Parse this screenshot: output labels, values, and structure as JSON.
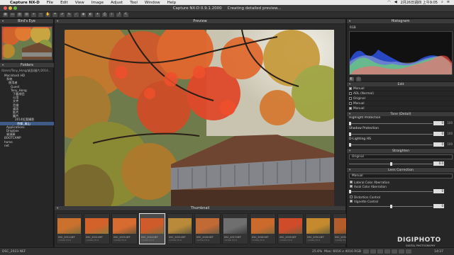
{
  "menubar": {
    "apple": "",
    "app": "Capture NX-D",
    "items": [
      "File",
      "Edit",
      "View",
      "Image",
      "Adjust",
      "Tool",
      "Window",
      "Help"
    ],
    "clock": "2月26日週四 上午9:05"
  },
  "window": {
    "title": "Capture NX-D 0.9.1.2000",
    "status": "Creating detailed preview..."
  },
  "left": {
    "birdseye_title": "Bird's Eye",
    "folders_title": "Folders",
    "path": "/Users/Tony_Hong/桌面/圖片/2014...",
    "tree": [
      {
        "label": "Macintosh HD",
        "sel": false
      },
      {
        "label": "系統",
        "sel": false
      },
      {
        "label": "使用者",
        "sel": false
      },
      {
        "label": "Guest",
        "sel": false
      },
      {
        "label": "Tony_Hong",
        "sel": false
      },
      {
        "label": "下載項目",
        "sel": false
      },
      {
        "label": "公用",
        "sel": false
      },
      {
        "label": "文件",
        "sel": false
      },
      {
        "label": "音樂",
        "sel": false
      },
      {
        "label": "桌面",
        "sel": false
      },
      {
        "label": "影片",
        "sel": false
      },
      {
        "label": "圖片",
        "sel": false
      },
      {
        "label": "2014紅葉攝影",
        "sel": false
      },
      {
        "label": "京都_嵐山",
        "sel": true
      },
      {
        "label": "Applications",
        "sel": false
      },
      {
        "label": "Dropbox",
        "sel": false
      },
      {
        "label": "資源庫",
        "sel": false
      },
      {
        "label": "BOOTCAMP",
        "sel": false
      },
      {
        "label": "home",
        "sel": false
      },
      {
        "label": "net",
        "sel": false
      }
    ]
  },
  "preview": {
    "title": "Preview"
  },
  "thumbnail": {
    "title": "Thumbnail",
    "items": [
      {
        "name": "DSC_2021.NEF",
        "meta": "1/200s f/5.6"
      },
      {
        "name": "DSC_2022.NEF",
        "meta": "1/200s f/5.6"
      },
      {
        "name": "DSC_2023.NEF",
        "meta": "1/200s f/5.6"
      },
      {
        "name": "DSC_2024.NEF",
        "meta": "1/200s f/5.6"
      },
      {
        "name": "DSC_2025.NEF",
        "meta": "1/250s f/5.6"
      },
      {
        "name": "DSC_2026.NEF",
        "meta": "1/250s f/5.6"
      },
      {
        "name": "DSC_2027.NEF",
        "meta": "1/160s f/5.6"
      },
      {
        "name": "DSC_2028.NEF",
        "meta": "1/160s f/5.6"
      },
      {
        "name": "DSC_2029.NEF",
        "meta": "1/200s f/5.6"
      },
      {
        "name": "DSC_2030.NEF",
        "meta": "1/200s f/5.6"
      },
      {
        "name": "DSC_2031.NEF",
        "meta": "1/200s f/5.6"
      }
    ]
  },
  "right": {
    "histogram_title": "Histogram",
    "hist_mode": "RGB",
    "edit_title": "Edit",
    "edit_rows": [
      {
        "label": "Manual",
        "on": true
      },
      {
        "label": "ADL (Normal)",
        "on": false
      },
      {
        "label": "Original",
        "on": false
      },
      {
        "label": "Manual",
        "on": false
      },
      {
        "label": "Manual",
        "on": true
      }
    ],
    "tone_title": "Tone (Detail)",
    "sliders": [
      {
        "label": "Highlight Protection",
        "value": "0",
        "max": "100",
        "pos": 0.0
      },
      {
        "label": "Shadow Protection",
        "value": "0",
        "max": "100",
        "pos": 0.0
      },
      {
        "label": "D-Lighting HS",
        "value": "0",
        "max": "100",
        "pos": 0.0
      }
    ],
    "straighten_title": "Straighten",
    "straighten_mode": "Original",
    "straighten_value": "0.0",
    "lens_title": "Lens Correction",
    "lens_mode": "Manual",
    "lens_checks": [
      "Lateral Color Aberration",
      "Axial Color Aberration"
    ],
    "lens_value": "0",
    "lens_checks2": [
      "Distortion Control",
      "Vignette Control"
    ],
    "vignette_value": "0"
  },
  "status": {
    "file": "DSC_2023.NEF",
    "zoom": "25.6%",
    "info": "Max: 6016 x 4016  RGB",
    "count": "14/37"
  },
  "watermark": {
    "main": "DIGIPHOTO",
    "sub": "DIGITAL PHOTOGRAPHY"
  }
}
